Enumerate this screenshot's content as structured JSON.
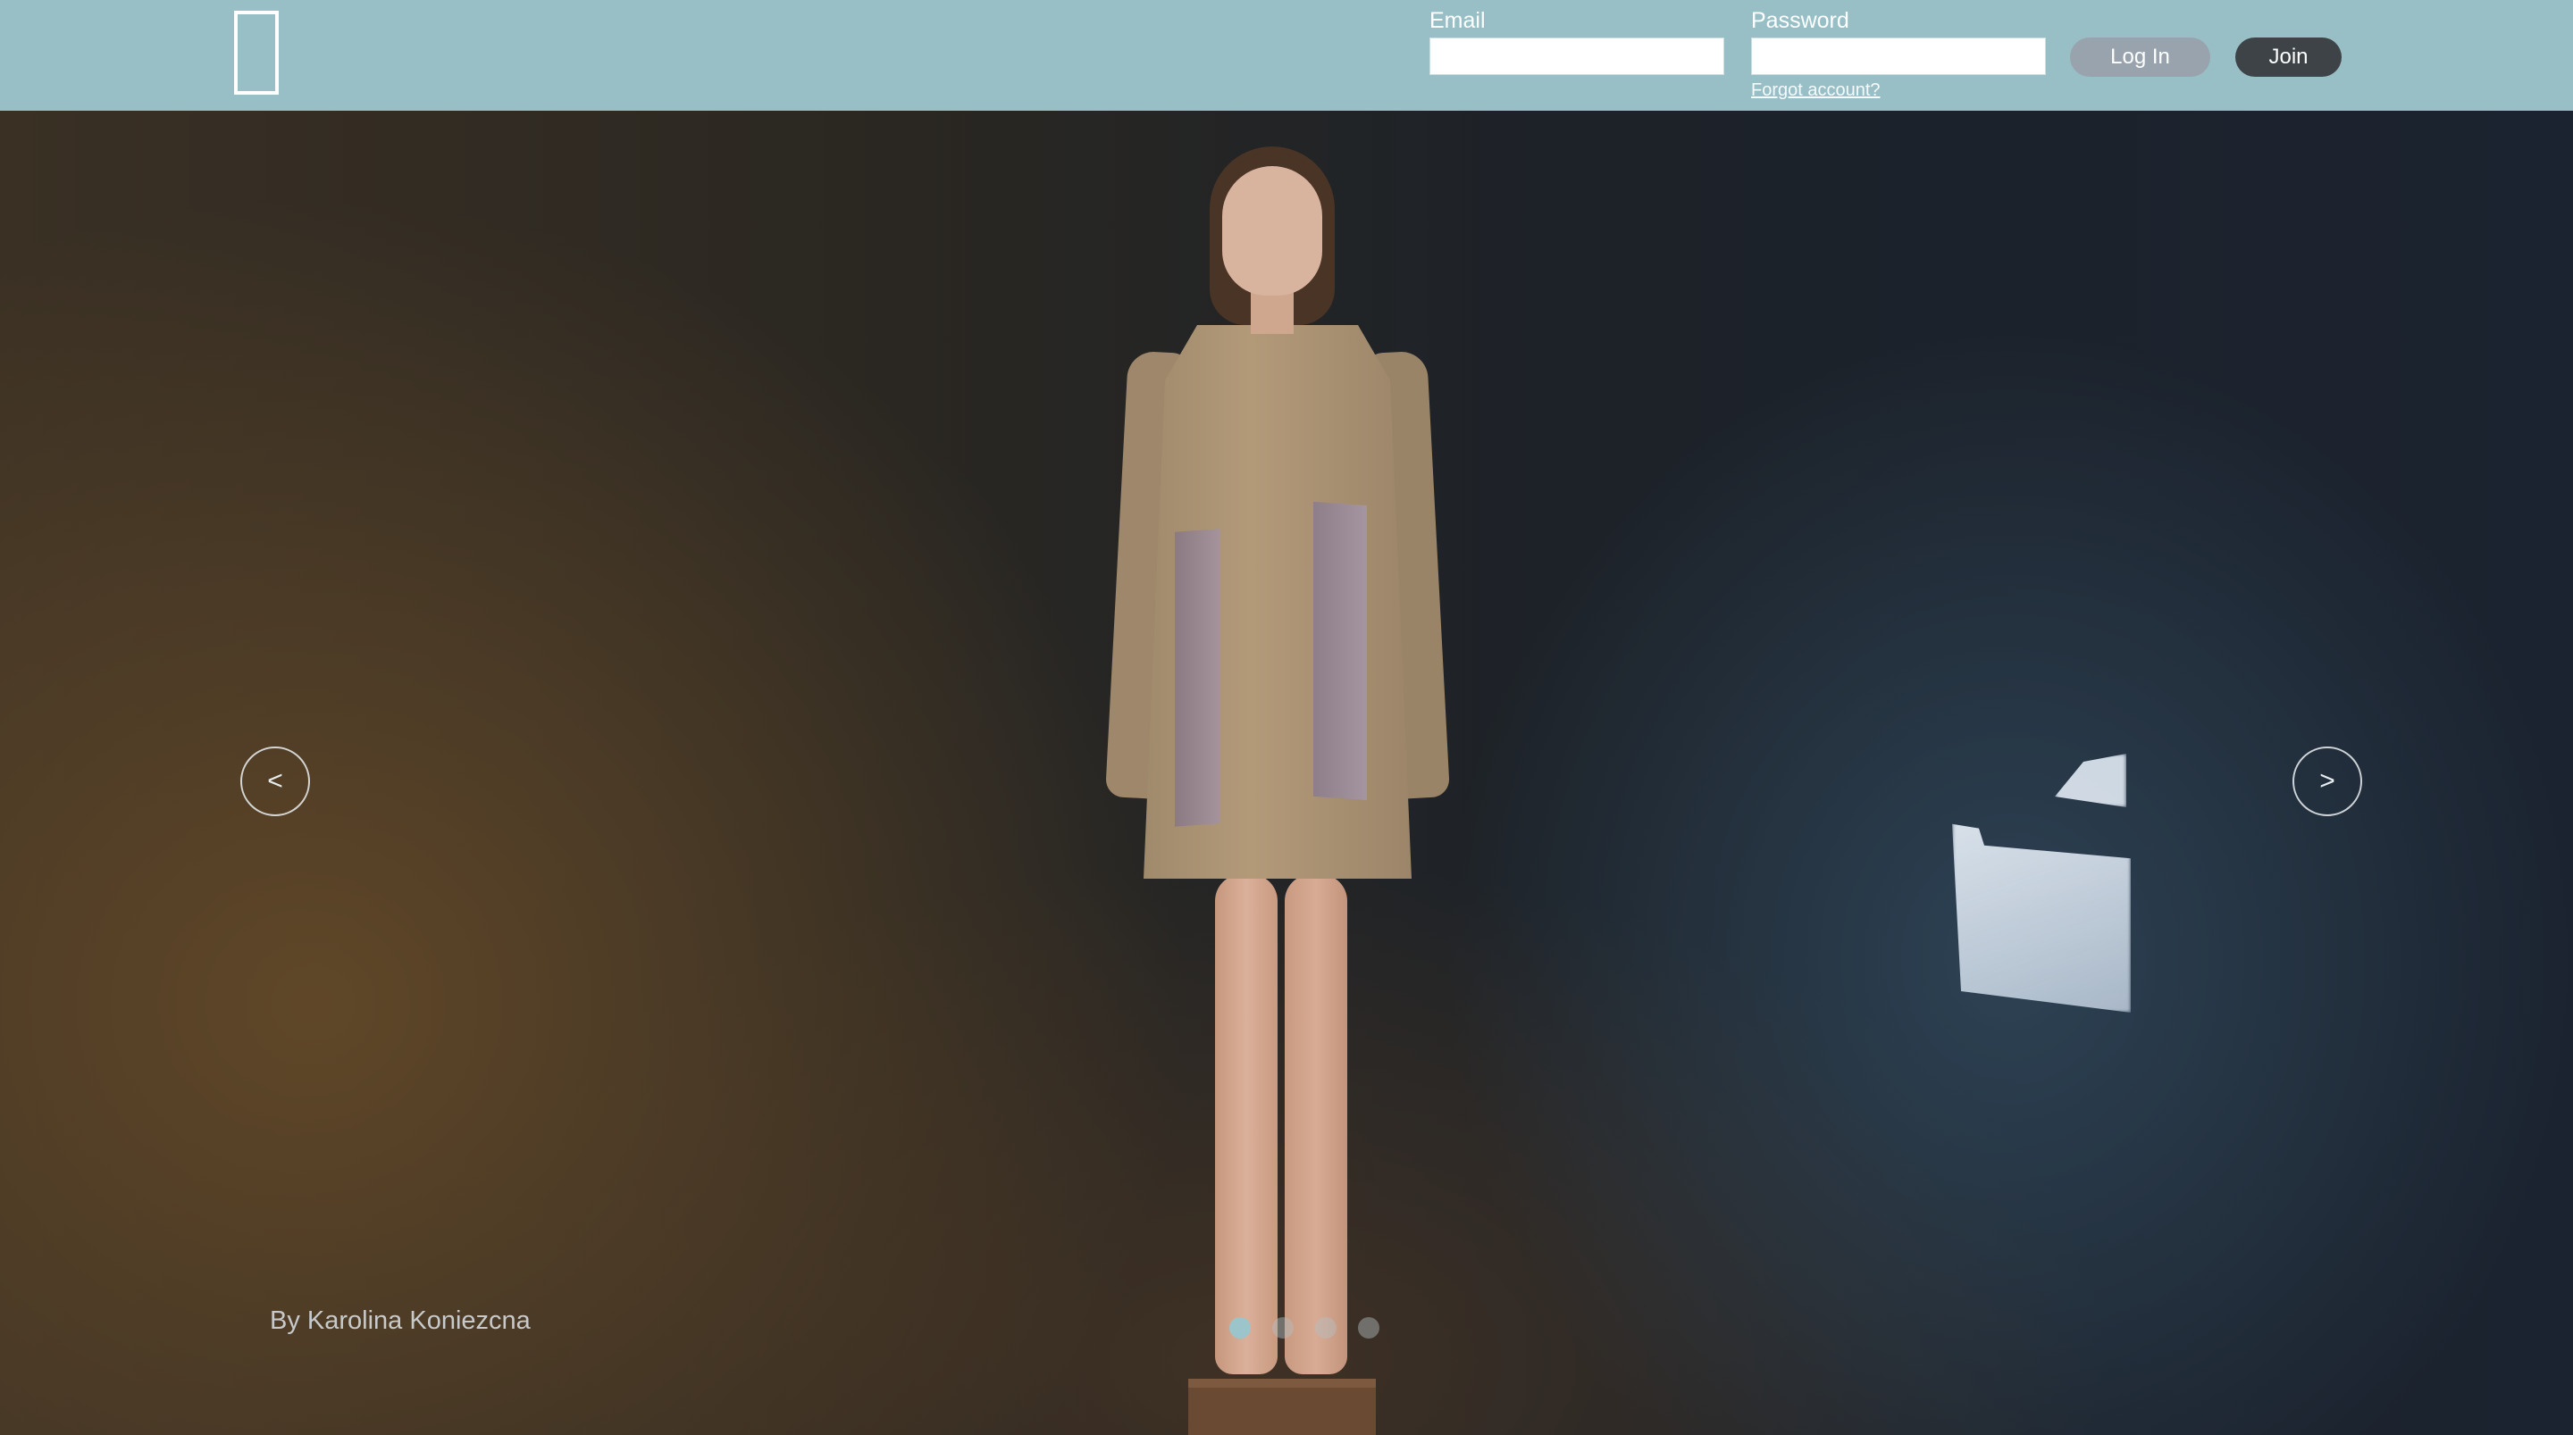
{
  "header": {
    "email_label": "Email",
    "email_value": "",
    "password_label": "Password",
    "password_value": "",
    "forgot_link": "Forgot account?",
    "login_button": "Log In",
    "join_button": "Join"
  },
  "carousel": {
    "prev_glyph": "<",
    "next_glyph": ">",
    "caption": "By Karolina Koniezcna",
    "slide_count": 4,
    "active_index": 0
  },
  "colors": {
    "header_bg": "#98bfc6",
    "login_button_bg": "#98a3ad",
    "join_button_bg": "#3d4346",
    "active_dot": "#9cc4cb"
  },
  "icons": {
    "logo": "door-outline-logo"
  }
}
